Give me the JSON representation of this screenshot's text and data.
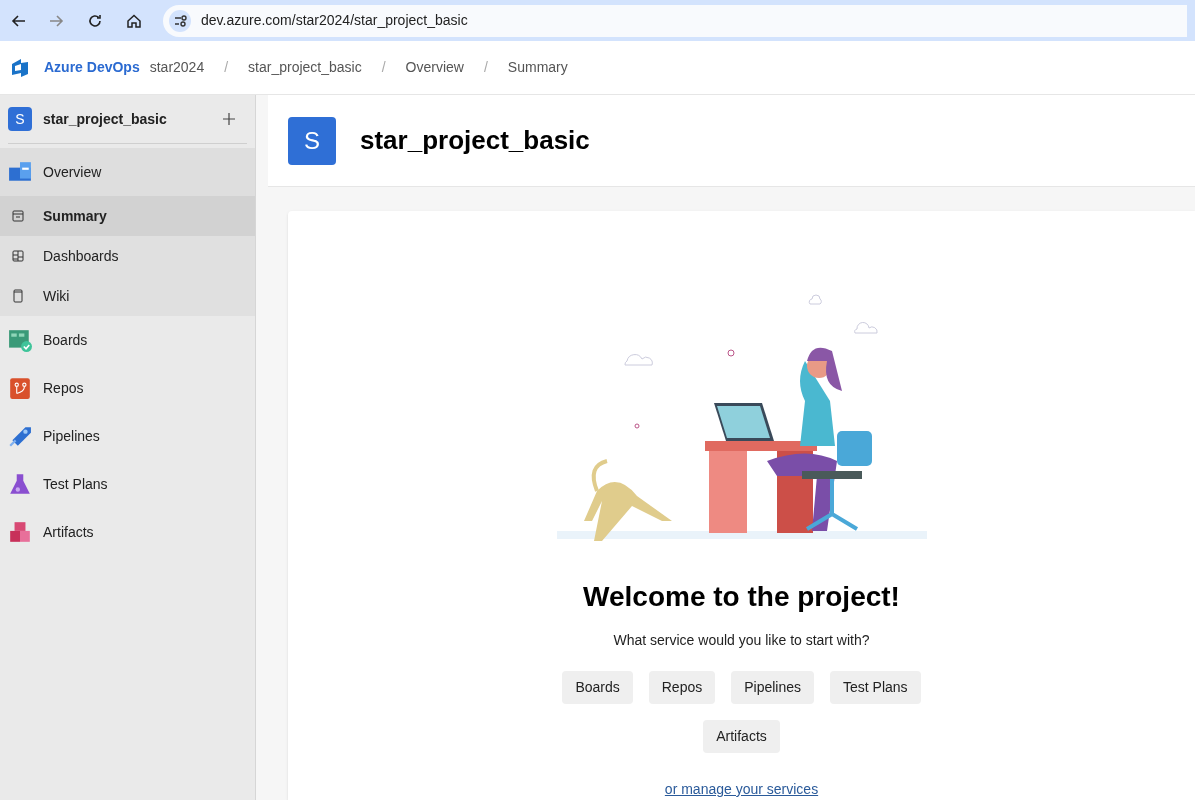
{
  "browser": {
    "url": "dev.azure.com/star2024/star_project_basic"
  },
  "header": {
    "brand": "Azure DevOps",
    "breadcrumbs": [
      "star2024",
      "star_project_basic",
      "Overview",
      "Summary"
    ],
    "separators": [
      "/",
      "/",
      "/"
    ]
  },
  "sidebar": {
    "project": {
      "avatar": "S",
      "name": "star_project_basic"
    },
    "items": [
      {
        "label": "Overview",
        "selected": true,
        "children": [
          {
            "label": "Summary",
            "selected": true
          },
          {
            "label": "Dashboards",
            "selected": false
          },
          {
            "label": "Wiki",
            "selected": false
          }
        ]
      },
      {
        "label": "Boards",
        "selected": false
      },
      {
        "label": "Repos",
        "selected": false
      },
      {
        "label": "Pipelines",
        "selected": false
      },
      {
        "label": "Test Plans",
        "selected": false
      },
      {
        "label": "Artifacts",
        "selected": false
      }
    ]
  },
  "page": {
    "avatar": "S",
    "title": "star_project_basic"
  },
  "welcome": {
    "heading": "Welcome to the project!",
    "question": "What service would you like to start with?",
    "services": [
      "Boards",
      "Repos",
      "Pipelines",
      "Test Plans",
      "Artifacts"
    ],
    "link": "or manage your services"
  }
}
